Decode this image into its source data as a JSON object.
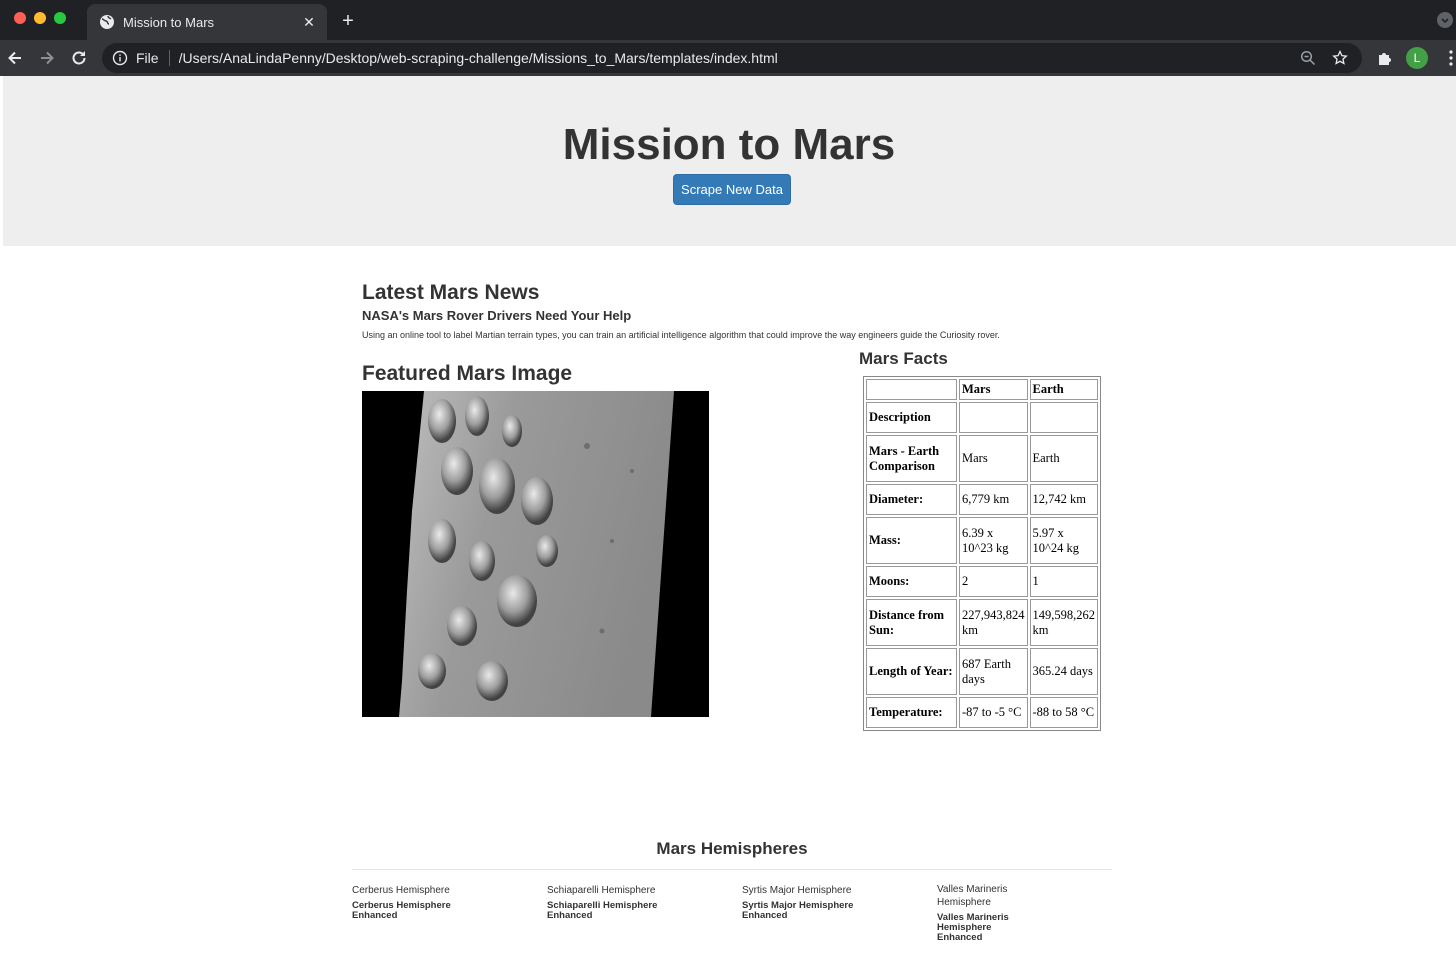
{
  "browser": {
    "tab_title": "Mission to Mars",
    "omnibox_scheme": "File",
    "url": "/Users/AnaLindaPenny/Desktop/web-scraping-challenge/Missions_to_Mars/templates/index.html",
    "profile_initial": "L"
  },
  "header": {
    "title": "Mission to Mars",
    "scrape_button": "Scrape New Data"
  },
  "news": {
    "heading": "Latest Mars News",
    "title": "NASA's Mars Rover Drivers Need Your Help",
    "paragraph": "Using an online tool to label Martian terrain types, you can train an artificial intelligence algorithm that could improve the way engineers guide the Curiosity rover."
  },
  "featured": {
    "heading": "Featured Mars Image"
  },
  "facts": {
    "heading": "Mars Facts",
    "columns": [
      "",
      "Mars",
      "Earth"
    ],
    "rows": [
      [
        "Description",
        "",
        ""
      ],
      [
        "Mars - Earth Comparison",
        "Mars",
        "Earth"
      ],
      [
        "Diameter:",
        "6,779 km",
        "12,742 km"
      ],
      [
        "Mass:",
        "6.39 x 10^23 kg",
        "5.97 x 10^24 kg"
      ],
      [
        "Moons:",
        "2",
        "1"
      ],
      [
        "Distance from Sun:",
        "227,943,824 km",
        "149,598,262 km"
      ],
      [
        "Length of Year:",
        "687 Earth days",
        "365.24 days"
      ],
      [
        "Temperature:",
        "-87 to -5 °C",
        "-88 to 58 °C"
      ]
    ]
  },
  "hemispheres": {
    "heading": "Mars Hemispheres",
    "items": [
      {
        "alt": "Cerberus Hemisphere",
        "caption": "Cerberus Hemisphere Enhanced"
      },
      {
        "alt": "Schiaparelli Hemisphere",
        "caption": "Schiaparelli Hemisphere Enhanced"
      },
      {
        "alt": "Syrtis Major Hemisphere",
        "caption": "Syrtis Major Hemisphere Enhanced"
      },
      {
        "alt": "Valles Marineris Hemisphere",
        "caption": "Valles Marineris Hemisphere Enhanced"
      }
    ]
  },
  "colors": {
    "button": "#337ab7",
    "jumbotron": "#eeeeee",
    "chrome_dark": "#202124"
  }
}
